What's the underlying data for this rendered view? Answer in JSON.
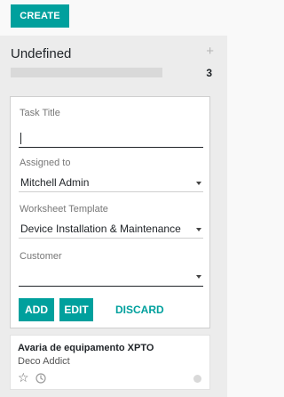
{
  "toolbar": {
    "create_label": "CREATE"
  },
  "column": {
    "title": "Undefined",
    "add_icon": "+",
    "count": "3"
  },
  "quick_create": {
    "title_label": "Task Title",
    "title_value": "",
    "assigned_label": "Assigned to",
    "assigned_value": "Mitchell Admin",
    "worksheet_label": "Worksheet Template",
    "worksheet_value": "Device Installation & Maintenance",
    "customer_label": "Customer",
    "customer_value": "",
    "add_label": "ADD",
    "edit_label": "EDIT",
    "discard_label": "DISCARD"
  },
  "task": {
    "name": "Avaria de equipamento XPTO",
    "customer": "Deco Addict",
    "star_icon": "☆",
    "icons": [
      "star-icon",
      "clock-icon",
      "status-dot"
    ]
  },
  "colors": {
    "accent": "#00a09d",
    "column_bg": "#ececec",
    "page_bg": "#f9f9f9"
  }
}
